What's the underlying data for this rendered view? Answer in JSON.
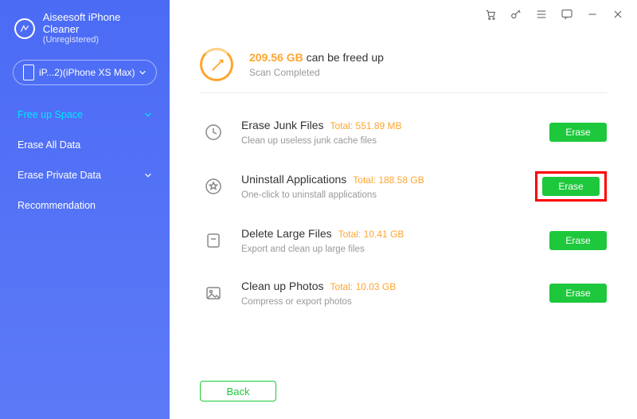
{
  "brand": {
    "title": "Aiseesoft iPhone Cleaner",
    "subtitle": "(Unregistered)"
  },
  "device": {
    "label": "iP...2)(iPhone XS Max)"
  },
  "nav": {
    "free_up_space": "Free up Space",
    "erase_all_data": "Erase All Data",
    "erase_private_data": "Erase Private Data",
    "recommendation": "Recommendation"
  },
  "summary": {
    "amount": "209.56 GB",
    "headline_rest": "can be freed up",
    "status": "Scan Completed"
  },
  "items": [
    {
      "title": "Erase Junk Files",
      "total_label": "Total:",
      "total": "551.89 MB",
      "sub": "Clean up useless junk cache files",
      "btn": "Erase",
      "highlight": false
    },
    {
      "title": "Uninstall Applications",
      "total_label": "Total:",
      "total": "188.58 GB",
      "sub": "One-click to uninstall applications",
      "btn": "Erase",
      "highlight": true
    },
    {
      "title": "Delete Large Files",
      "total_label": "Total:",
      "total": "10.41 GB",
      "sub": "Export and clean up large files",
      "btn": "Erase",
      "highlight": false
    },
    {
      "title": "Clean up Photos",
      "total_label": "Total:",
      "total": "10.03 GB",
      "sub": "Compress or export photos",
      "btn": "Erase",
      "highlight": false
    }
  ],
  "footer": {
    "back": "Back"
  }
}
